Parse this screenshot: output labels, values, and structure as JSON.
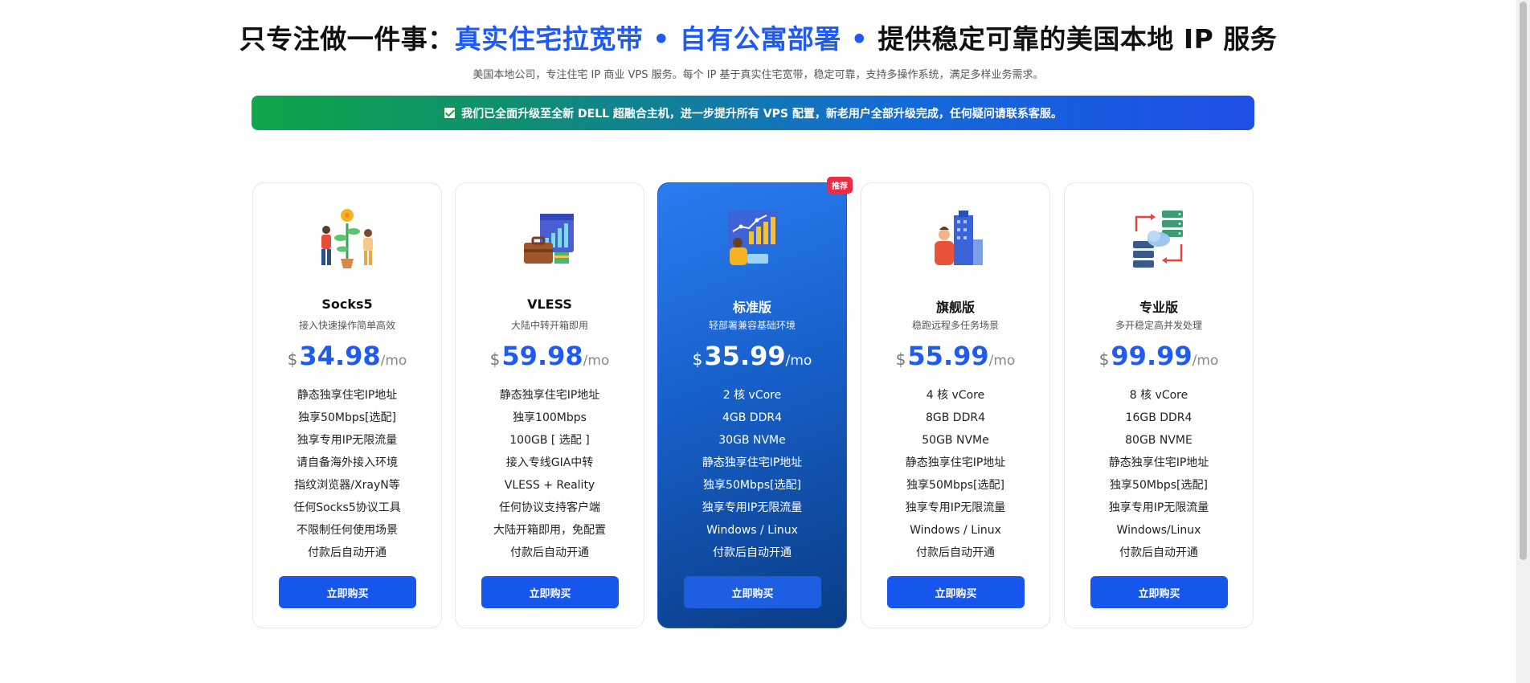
{
  "header": {
    "title_prefix": "只专注做一件事：",
    "title_highlight": "真实住宅拉宽带 • 自有公寓部署 •",
    "title_suffix": " 提供稳定可靠的美国本地 IP 服务",
    "subtitle": "美国本地公司，专注住宅 IP 商业 VPS 服务。每个 IP 基于真实住宅宽带，稳定可靠，支持多操作系统，满足多样业务需求。"
  },
  "banner": {
    "text": "我们已全面升级至全新 DELL 超融合主机，进一步提升所有 VPS 配置，新老用户全部升级完成，任何疑问请联系客服。"
  },
  "colors": {
    "accent": "#1f5bf0",
    "button": "#1756ec",
    "badge": "#ef2b43"
  },
  "plans": [
    {
      "name": "Socks5",
      "tagline": "接入快速操作简单高效",
      "currency": "$",
      "price": "34.98",
      "period": "/mo",
      "illustration": "people-growing-money-plant-icon",
      "features": [
        "静态独享住宅IP地址",
        "独享50Mbps[选配]",
        "独享专用IP无限流量",
        "请自备海外接入环境",
        "指纹浏览器/XrayN等",
        "任何Socks5协议工具",
        "不限制任何使用场景",
        "付款后自动开通"
      ],
      "button": "立即购买"
    },
    {
      "name": "VLESS",
      "tagline": "大陆中转开箱即用",
      "currency": "$",
      "price": "59.98",
      "period": "/mo",
      "illustration": "briefcase-dashboard-icon",
      "features": [
        "静态独享住宅IP地址",
        "独享100Mbps",
        "100GB [ 选配 ]",
        "接入专线GIA中转",
        "VLESS + Reality",
        "任何协议支持客户端",
        "大陆开箱即用，免配置",
        "付款后自动开通"
      ],
      "button": "立即购买"
    },
    {
      "name": "标准版",
      "tagline": "轻部署兼容基础环境",
      "currency": "$",
      "price": "35.99",
      "period": "/mo",
      "badge": "推荐",
      "illustration": "analyst-growth-chart-icon",
      "features": [
        "2 核 vCore",
        "4GB DDR4",
        "30GB NVMe",
        "静态独享住宅IP地址",
        "独享50Mbps[选配]",
        "独享专用IP无限流量",
        "Windows / Linux",
        "付款后自动开通"
      ],
      "button": "立即购买"
    },
    {
      "name": "旗舰版",
      "tagline": "稳跑远程多任务场景",
      "currency": "$",
      "price": "55.99",
      "period": "/mo",
      "illustration": "businessman-office-building-icon",
      "features": [
        "4 核 vCore",
        "8GB DDR4",
        "50GB NVMe",
        "静态独享住宅IP地址",
        "独享50Mbps[选配]",
        "独享专用IP无限流量",
        "Windows / Linux",
        "付款后自动开通"
      ],
      "button": "立即购买"
    },
    {
      "name": "专业版",
      "tagline": "多开稳定高并发处理",
      "currency": "$",
      "price": "99.99",
      "period": "/mo",
      "illustration": "server-cloud-sync-icon",
      "features": [
        "8 核 vCore",
        "16GB DDR4",
        "80GB NVME",
        "静态独享住宅IP地址",
        "独享50Mbps[选配]",
        "独享专用IP无限流量",
        "Windows/Linux",
        "付款后自动开通"
      ],
      "button": "立即购买"
    }
  ]
}
